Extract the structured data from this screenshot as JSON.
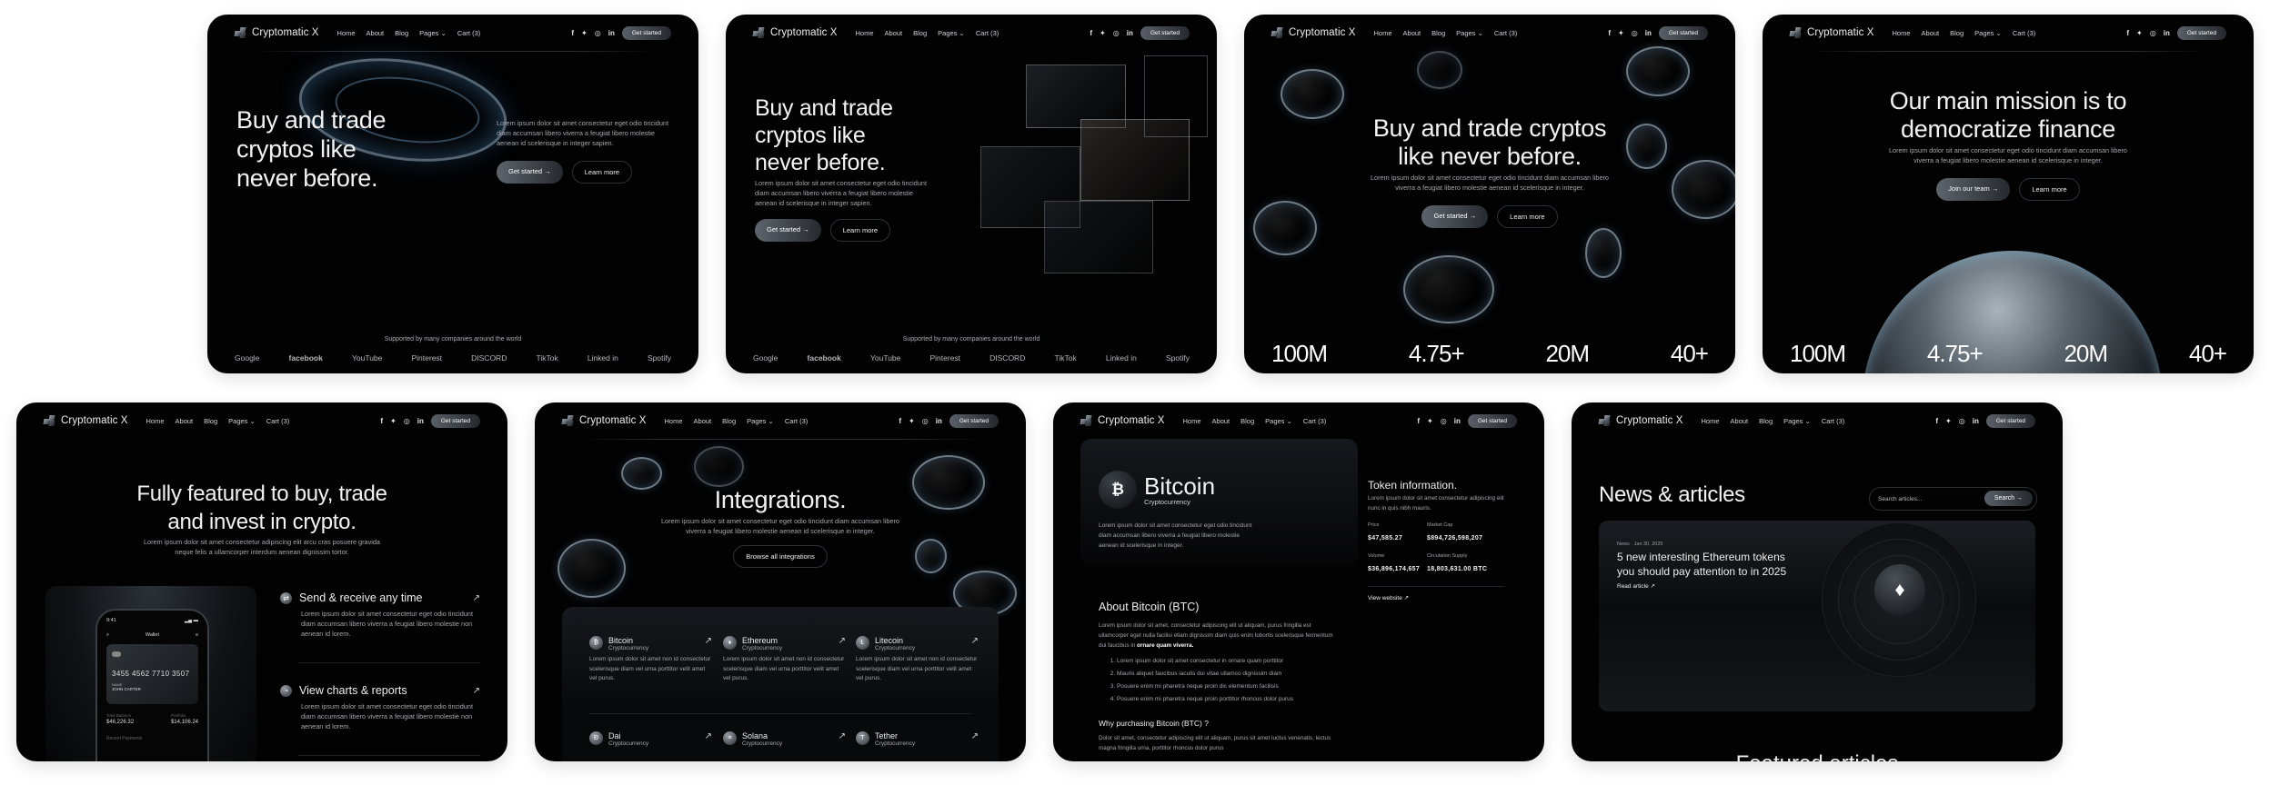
{
  "brand": "Cryptomatic X",
  "nav": {
    "links": [
      "Home",
      "About",
      "Blog",
      "Pages",
      "Cart (3)"
    ],
    "pages_dropdown_indicator": "⌄",
    "social_icons": [
      "facebook-icon",
      "twitter-icon",
      "instagram-icon",
      "linkedin-icon"
    ],
    "social_glyphs": [
      "f",
      "🐦",
      "◎",
      "in"
    ],
    "cta": "Get started"
  },
  "common": {
    "get_started": "Get started →",
    "learn_more": "Learn more",
    "arrow": "↗"
  },
  "panel1": {
    "title_lines": [
      "Buy and trade",
      "cryptos like",
      "never before."
    ],
    "body": "Lorem ipsum dolor sit amet consectetur eget odio tincidunt diam accumsan libero viverra a feugiat libero molestie aenean id scelerisque in integer sapien.",
    "supported": "Supported by many companies around the world",
    "partners": [
      "Google",
      "facebook",
      "YouTube",
      "Pinterest",
      "DISCORD",
      "TikTok",
      "Linked in",
      "Spotify"
    ]
  },
  "panel2": {
    "title_lines": [
      "Buy and trade",
      "cryptos like",
      "never before."
    ],
    "body": "Lorem ipsum dolor sit amet consectetur eget odio tincidunt diam accumsan libero viverra a feugiat libero molestie aenean id scelerisque in integer sapien.",
    "supported": "Supported by many companies around the world",
    "partners": [
      "Google",
      "facebook",
      "YouTube",
      "Pinterest",
      "DISCORD",
      "TikTok",
      "Linked in",
      "Spotify"
    ]
  },
  "panel3": {
    "title_lines": [
      "Buy and trade cryptos",
      "like never before."
    ],
    "body": "Lorem ipsum dolor sit amet consectetur eget odio tincidunt diam accumsan libero viverra a feugiat libero molestie aenean id scelerisque in integer.",
    "stats": [
      "100M",
      "4.75+",
      "20M",
      "40+"
    ]
  },
  "panel4": {
    "title_lines": [
      "Our main mission is to",
      "democratize finance"
    ],
    "body": "Lorem ipsum dolor sit amet consectetur eget odio tincidunt diam accumsan libero viverra a feugiat libero molestie aenean id scelerisque in integer.",
    "join": "Join our team →",
    "stats": [
      "100M",
      "4.75+",
      "20M",
      "40+"
    ]
  },
  "panel5": {
    "title_lines": [
      "Fully featured to buy, trade",
      "and invest in crypto."
    ],
    "body": "Lorem ipsum dolor sit amet consectetur adipiscing elit arcu cras posuere gravida neque felis a ullamcorper interdum aenean dignissim tortor.",
    "features": [
      {
        "title": "Send & receive any time",
        "body": "Lorem ipsum dolor sit amet consectetur eget odio tincidunt diam accumsan libero viverra a feugiat libero molestie non aenean id lorem."
      },
      {
        "title": "View charts & reports",
        "body": "Lorem ipsum dolor sit amet consectetur eget odio tincidunt diam accumsan libero viverra a feugiat libero molestie non aenean id lorem."
      }
    ],
    "phone": {
      "time": "9:41",
      "title": "Wallet",
      "card_number": "3455 4562 7710 3507",
      "card_holder_label": "NAME",
      "card_holder": "JOHN CARTER",
      "total_label": "Total Balance",
      "total": "$46,226.32",
      "portfolio_label": "Portfolio",
      "portfolio": "$14,106.24",
      "recent_label": "Recent Payments"
    }
  },
  "panel6": {
    "title": "Integrations.",
    "body": "Lorem ipsum dolor sit amet consectetur eget odio tincidunt diam accumsan libero viverra a feugiat libero molestie aenean id scelerisque in integer.",
    "browse": "Browse all integrations",
    "coins": [
      {
        "name": "Bitcoin",
        "type": "Cryptocurrency",
        "glyph": "₿",
        "body": "Lorem ipsum dolor sit amet non id consectetur scelerisque diam vel urna porttitor velit amet vel purus."
      },
      {
        "name": "Ethereum",
        "type": "Cryptocurrency",
        "glyph": "♦",
        "body": "Lorem ipsum dolor sit amet non id consectetur scelerisque diam vel urna porttitor velit amet vel purus."
      },
      {
        "name": "Litecoin",
        "type": "Cryptocurrency",
        "glyph": "Ł",
        "body": "Lorem ipsum dolor sit amet non id consectetur scelerisque diam vel urna porttitor velit amet vel purus."
      },
      {
        "name": "Dai",
        "type": "Cryptocurrency",
        "glyph": "Ð",
        "body": ""
      },
      {
        "name": "Solana",
        "type": "Cryptocurrency",
        "glyph": "≡",
        "body": ""
      },
      {
        "name": "Tether",
        "type": "Cryptocurrency",
        "glyph": "T",
        "body": ""
      }
    ]
  },
  "panel7": {
    "coin_name": "Bitcoin",
    "coin_type": "Cryptocurrency",
    "coin_glyph": "₿",
    "coin_body": "Lorem ipsum dolor sit amet consectetur eget odio tincidunt diam accumsan libero viverra a feugiat libero molestie aenean id scelerisque in integer.",
    "token_title": "Token information.",
    "token_body": "Lorem ipsum dolor sit amet consectetur adipiscing elit nunc in quis nibh mauris.",
    "price_label": "Price",
    "price": "$47,585.27",
    "mcap_label": "Market Cap",
    "mcap": "$894,726,598,207",
    "volume_label": "Volume",
    "volume": "$36,896,174,657",
    "supply_label": "Circulation Supply",
    "supply": "18,803,631.00 BTC",
    "view_website": "View website ↗",
    "about_title": "About Bitcoin (BTC)",
    "about_body": "Lorem ipsum dolor sit amet, consectetur adipiscing elit ut aliquam, purus fringilla est ullamcorper eget nulla facilisi etiam dignissim diam quis enim lobortis scelerisque fermentum dui faucibus in",
    "about_bold": "ornare quam viverra.",
    "list": [
      "Lorem ipsum dolor sit amet consectetur in ornare quam porttitor",
      "Mauris aliquet faucibus iaculis dui vitae ullamco dignissim diam",
      "Posuere enim mi pharetra neque proin dic elementum facilisis",
      "Posuere enim mi pharetra neque proin porttitor rhoncus dolor purus"
    ],
    "why_title": "Why purchasing Bitcoin (BTC) ?",
    "why_body": "Dolor sit amet, consectetur adipiscing elit ut aliquam, purus sit amet luctus venenatis, lectus magna fringilla urna, porttitor rhoncus dolor purus"
  },
  "panel8": {
    "title": "News & articles",
    "search_placeholder": "Search articles...",
    "search_button": "Search →",
    "article_meta": "News · Jan 30, 2025",
    "article_title": "5 new interesting Ethereum tokens you should pay attention to in 2025",
    "read_article": "Read article ↗",
    "next_heading_partial": "Featured articles"
  }
}
